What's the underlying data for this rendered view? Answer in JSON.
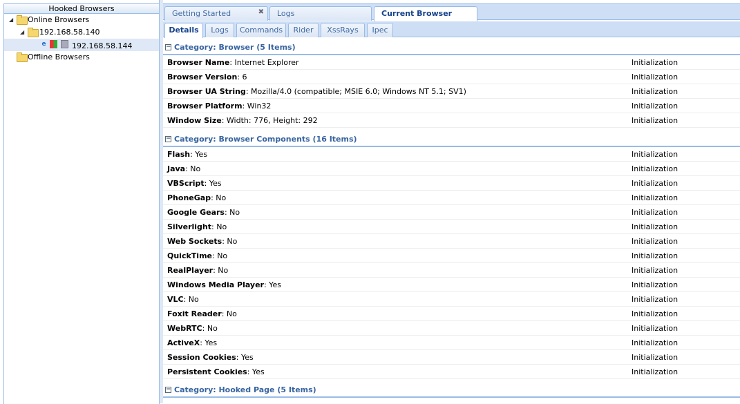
{
  "left_panel": {
    "title": "Hooked Browsers",
    "online_label": "Online Browsers",
    "host_label": "192.168.58.140",
    "browser_label": "192.168.58.144",
    "offline_label": "Offline Browsers"
  },
  "main_tabs": [
    {
      "label": "Getting Started",
      "active": false,
      "closable": true
    },
    {
      "label": "Logs",
      "active": false,
      "closable": false
    },
    {
      "label": "Current Browser",
      "active": true,
      "closable": false
    }
  ],
  "sub_tabs": [
    {
      "label": "Details",
      "active": true
    },
    {
      "label": "Logs",
      "active": false
    },
    {
      "label": "Commands",
      "active": false
    },
    {
      "label": "Rider",
      "active": false
    },
    {
      "label": "XssRays",
      "active": false
    },
    {
      "label": "Ipec",
      "active": false
    }
  ],
  "groups": [
    {
      "header": "Category: Browser (5 Items)",
      "rows": [
        {
          "key": "Browser Name",
          "value": ": Internet Explorer",
          "source": "Initialization"
        },
        {
          "key": "Browser Version",
          "value": ": 6",
          "source": "Initialization"
        },
        {
          "key": "Browser UA String",
          "value": ": Mozilla/4.0 (compatible; MSIE 6.0; Windows NT 5.1; SV1)",
          "source": "Initialization"
        },
        {
          "key": "Browser Platform",
          "value": ": Win32",
          "source": "Initialization"
        },
        {
          "key": "Window Size",
          "value": ": Width: 776, Height: 292",
          "source": "Initialization"
        }
      ]
    },
    {
      "header": "Category: Browser Components (16 Items)",
      "rows": [
        {
          "key": "Flash",
          "value": ": Yes",
          "source": "Initialization"
        },
        {
          "key": "Java",
          "value": ": No",
          "source": "Initialization"
        },
        {
          "key": "VBScript",
          "value": ": Yes",
          "source": "Initialization"
        },
        {
          "key": "PhoneGap",
          "value": ": No",
          "source": "Initialization"
        },
        {
          "key": "Google Gears",
          "value": ": No",
          "source": "Initialization"
        },
        {
          "key": "Silverlight",
          "value": ": No",
          "source": "Initialization"
        },
        {
          "key": "Web Sockets",
          "value": ": No",
          "source": "Initialization"
        },
        {
          "key": "QuickTime",
          "value": ": No",
          "source": "Initialization"
        },
        {
          "key": "RealPlayer",
          "value": ": No",
          "source": "Initialization"
        },
        {
          "key": "Windows Media Player",
          "value": ": Yes",
          "source": "Initialization"
        },
        {
          "key": "VLC",
          "value": ": No",
          "source": "Initialization"
        },
        {
          "key": "Foxit Reader",
          "value": ": No",
          "source": "Initialization"
        },
        {
          "key": "WebRTC",
          "value": ": No",
          "source": "Initialization"
        },
        {
          "key": "ActiveX",
          "value": ": Yes",
          "source": "Initialization"
        },
        {
          "key": "Session Cookies",
          "value": ": Yes",
          "source": "Initialization"
        },
        {
          "key": "Persistent Cookies",
          "value": ": Yes",
          "source": "Initialization"
        }
      ]
    },
    {
      "header": "Category: Hooked Page (5 Items)",
      "rows": []
    }
  ]
}
